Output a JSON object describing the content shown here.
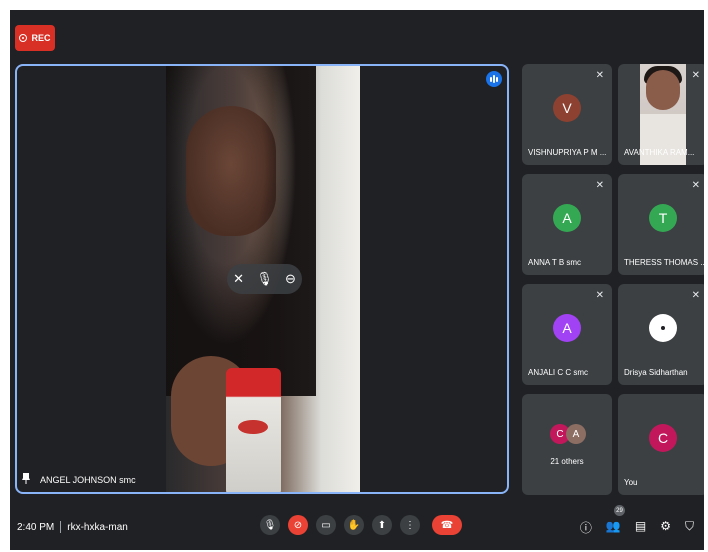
{
  "recording": {
    "label": "REC"
  },
  "main": {
    "name": "ANGEL JOHNSON smc"
  },
  "participants": [
    {
      "name": "VISHNUPRIYA P M ...",
      "initial": "V",
      "color": "#8d4131"
    },
    {
      "name": "AVANTHIKA RAM...",
      "initial": "",
      "color": ""
    },
    {
      "name": "ANNA T B smc",
      "initial": "A",
      "color": "#34a853"
    },
    {
      "name": "THERESS THOMAS ...",
      "initial": "T",
      "color": "#34a853"
    },
    {
      "name": "ANJALI C C smc",
      "initial": "A",
      "color": "#a142f4"
    },
    {
      "name": "Drisya Sidharthan",
      "initial": "",
      "color": "#ffffff"
    }
  ],
  "others": {
    "label": "21 others",
    "avatars": [
      {
        "initial": "C",
        "color": "#c2185b"
      },
      {
        "initial": "A",
        "color": "#8d6e63"
      }
    ]
  },
  "self": {
    "name": "You",
    "initial": "C",
    "color": "#c2185b"
  },
  "meeting": {
    "time": "2:40 PM",
    "code": "rkx-hxka-man",
    "participant_count": "29"
  }
}
